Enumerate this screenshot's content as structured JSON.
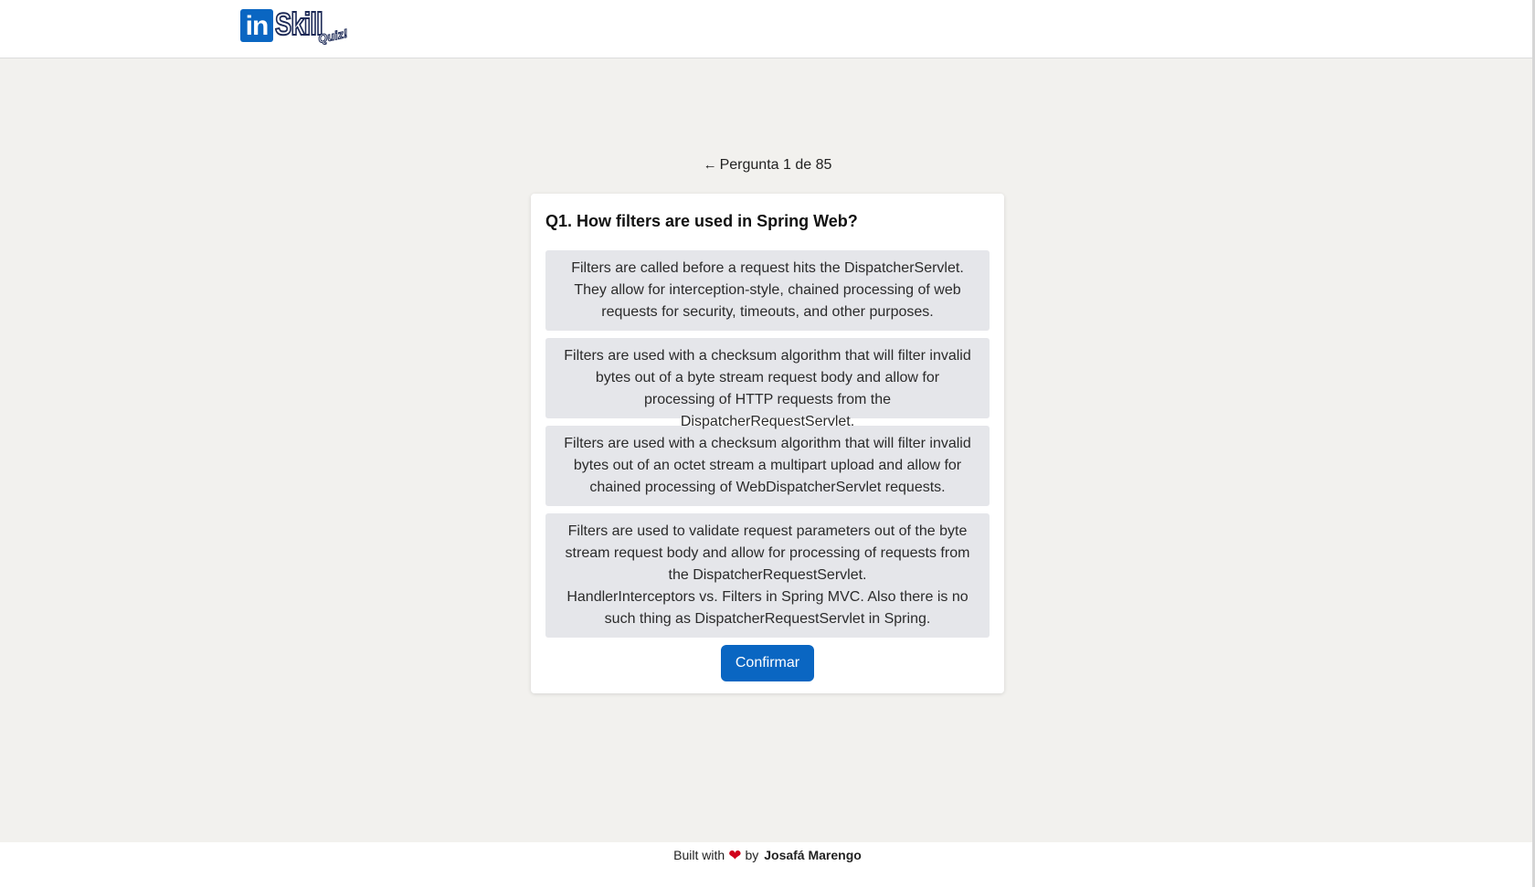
{
  "header": {
    "logo": {
      "in": "in",
      "skill": "Skill",
      "quiz": "Quiz!"
    }
  },
  "quiz": {
    "counter": "Pergunta 1 de 85",
    "question": "Q1. How filters are used in Spring Web?",
    "options": [
      {
        "lines": [
          "Filters are called before a request hits the DispatcherServlet.",
          "They allow for interception-style, chained processing of web",
          "requests for security, timeouts, and other purposes."
        ]
      },
      {
        "lines": [
          "Filters are used with a checksum algorithm that will filter invalid",
          "bytes out of a byte stream request body and allow for",
          "processing of HTTP requests from the DispatcherRequestServlet."
        ]
      },
      {
        "lines": [
          "Filters are used with a checksum algorithm that will filter invalid",
          "bytes out of an octet stream a multipart upload and allow for",
          "chained processing of WebDispatcherServlet requests."
        ]
      },
      {
        "lines": [
          "Filters are used to validate request parameters out of the byte",
          "stream request body and allow for processing of requests from",
          "the DispatcherRequestServlet.",
          "HandlerInterceptors vs. Filters in Spring MVC. Also there is no",
          "such thing as DispatcherRequestServlet in Spring."
        ]
      }
    ],
    "confirm_label": "Confirmar"
  },
  "footer": {
    "built_with": "Built with",
    "by": "by",
    "author": "Josafá Marengo"
  },
  "colors": {
    "brand": "#0a66c2",
    "background": "#f2f1ee",
    "option_bg": "#e5e6ea",
    "heart": "#d0021b"
  },
  "icons": {
    "back": "arrow-left-icon",
    "heart": "heart-icon"
  }
}
